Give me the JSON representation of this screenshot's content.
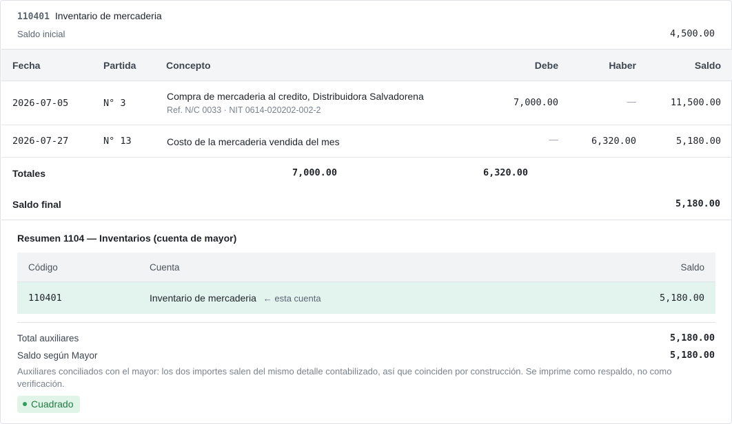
{
  "account": {
    "code": "110401",
    "name": "Inventario de mercaderia",
    "opening_label": "Saldo inicial",
    "opening_balance": "4,500.00"
  },
  "ledger": {
    "columns": {
      "date": "Fecha",
      "entry": "Partida",
      "concept": "Concepto",
      "debit": "Debe",
      "credit": "Haber",
      "balance": "Saldo"
    },
    "rows": [
      {
        "date": "2026-07-05",
        "entry": "N° 3",
        "concept": "Compra de mercaderia al credito, Distribuidora Salvadorena",
        "ref": "Ref. N/C 0033 · NIT 0614-020202-002-2",
        "debit": "7,000.00",
        "credit": "—",
        "balance": "11,500.00"
      },
      {
        "date": "2026-07-27",
        "entry": "N° 13",
        "concept": "Costo de la mercaderia vendida del mes",
        "ref": "",
        "debit": "—",
        "credit": "6,320.00",
        "balance": "5,180.00"
      }
    ],
    "totals_label": "Totales",
    "total_debit": "7,000.00",
    "total_credit": "6,320.00",
    "final_label": "Saldo final",
    "final_balance": "5,180.00"
  },
  "summary": {
    "title": "Resumen 1104 — Inventarios (cuenta de mayor)",
    "columns": {
      "code": "Código",
      "account": "Cuenta",
      "balance": "Saldo"
    },
    "row": {
      "code": "110401",
      "account": "Inventario de mercaderia",
      "note": "← esta cuenta",
      "balance": "5,180.00"
    },
    "total_aux_label": "Total auxiliares",
    "total_aux_value": "5,180.00",
    "ledger_label": "Saldo según Mayor",
    "ledger_value": "5,180.00",
    "explanation": "Auxiliares conciliados con el mayor: los dos importes salen del mismo detalle contabilizado, así que coinciden por construcción. Se imprime como respaldo, no como verificación.",
    "status": "Cuadrado",
    "status_color": "#2e9e5a"
  }
}
